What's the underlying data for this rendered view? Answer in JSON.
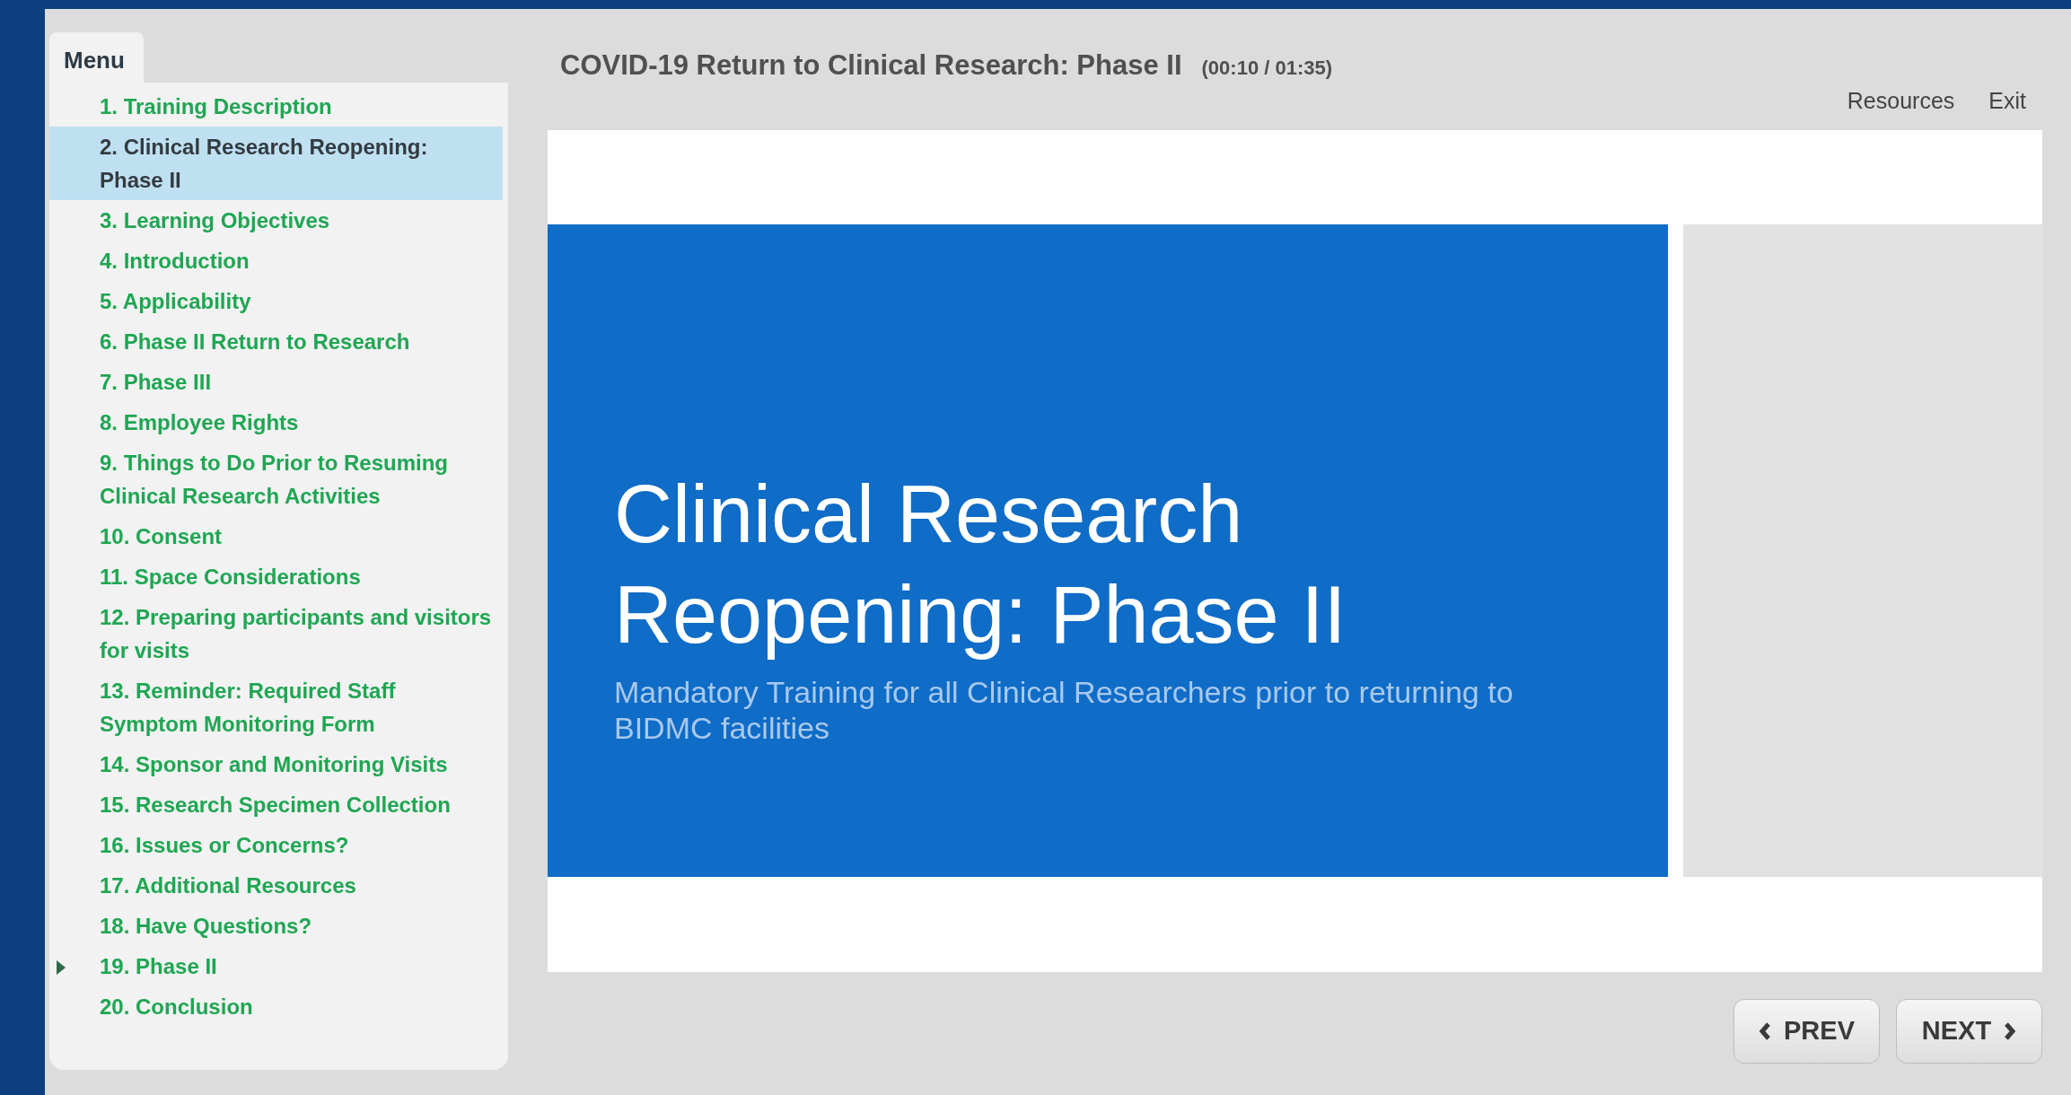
{
  "menu": {
    "title": "Menu",
    "items": [
      {
        "label": "1. Training Description",
        "selected": false,
        "expandable": false
      },
      {
        "label": "2. Clinical Research Reopening: Phase II",
        "selected": true,
        "expandable": false
      },
      {
        "label": "3. Learning Objectives",
        "selected": false,
        "expandable": false
      },
      {
        "label": "4. Introduction",
        "selected": false,
        "expandable": false
      },
      {
        "label": "5. Applicability",
        "selected": false,
        "expandable": false
      },
      {
        "label": "6. Phase II  Return to Research",
        "selected": false,
        "expandable": false
      },
      {
        "label": "7. Phase III",
        "selected": false,
        "expandable": false
      },
      {
        "label": "8. Employee Rights",
        "selected": false,
        "expandable": false
      },
      {
        "label": "9. Things to Do Prior to Resuming Clinical Research Activities",
        "selected": false,
        "expandable": false
      },
      {
        "label": "10. Consent",
        "selected": false,
        "expandable": false
      },
      {
        "label": "11. Space Considerations",
        "selected": false,
        "expandable": false
      },
      {
        "label": "12. Preparing participants and visitors for visits",
        "selected": false,
        "expandable": false
      },
      {
        "label": "13. Reminder: Required Staff Symptom Monitoring Form",
        "selected": false,
        "expandable": false
      },
      {
        "label": "14. Sponsor and Monitoring Visits",
        "selected": false,
        "expandable": false
      },
      {
        "label": "15. Research Specimen Collection",
        "selected": false,
        "expandable": false
      },
      {
        "label": "16. Issues or Concerns?",
        "selected": false,
        "expandable": false
      },
      {
        "label": "17. Additional Resources",
        "selected": false,
        "expandable": false
      },
      {
        "label": "18. Have Questions?",
        "selected": false,
        "expandable": false
      },
      {
        "label": "19. Phase II",
        "selected": false,
        "expandable": true
      },
      {
        "label": "20. Conclusion",
        "selected": false,
        "expandable": false
      }
    ]
  },
  "header": {
    "title": "COVID-19 Return to Clinical Research: Phase II",
    "time": "(00:10 / 01:35)",
    "links": [
      "Resources",
      "Exit"
    ]
  },
  "slide": {
    "title_lines": [
      "Clinical Research",
      "Reopening: Phase II"
    ],
    "subtitle": "Mandatory Training  for all Clinical Researchers prior to returning to BIDMC facilities"
  },
  "nav": {
    "prev": "PREV",
    "next": "NEXT"
  }
}
